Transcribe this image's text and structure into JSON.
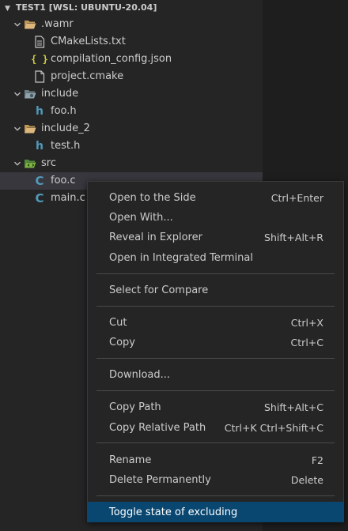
{
  "explorer": {
    "section_title": "TEST1 [WSL: UBUNTU-20.04]",
    "tree": [
      {
        "label": ".wamr",
        "kind": "folder",
        "expanded": true
      },
      {
        "label": "CMakeLists.txt",
        "kind": "file-lines"
      },
      {
        "label": "compilation_config.json",
        "kind": "json"
      },
      {
        "label": "project.cmake",
        "kind": "file-lines"
      },
      {
        "label": "include",
        "kind": "folder-special",
        "expanded": true
      },
      {
        "label": "foo.h",
        "kind": "h"
      },
      {
        "label": "include_2",
        "kind": "folder",
        "expanded": true
      },
      {
        "label": "test.h",
        "kind": "h"
      },
      {
        "label": "src",
        "kind": "folder-src",
        "expanded": true
      },
      {
        "label": "foo.c",
        "kind": "c"
      },
      {
        "label": "main.c",
        "kind": "c"
      }
    ]
  },
  "context_menu": {
    "items": [
      {
        "label": "Open to the Side",
        "shortcut": "Ctrl+Enter"
      },
      {
        "label": "Open With...",
        "shortcut": ""
      },
      {
        "label": "Reveal in Explorer",
        "shortcut": "Shift+Alt+R"
      },
      {
        "label": "Open in Integrated Terminal",
        "shortcut": ""
      },
      {
        "label": "Select for Compare",
        "shortcut": ""
      },
      {
        "label": "Cut",
        "shortcut": "Ctrl+X"
      },
      {
        "label": "Copy",
        "shortcut": "Ctrl+C"
      },
      {
        "label": "Download...",
        "shortcut": ""
      },
      {
        "label": "Copy Path",
        "shortcut": "Shift+Alt+C"
      },
      {
        "label": "Copy Relative Path",
        "shortcut": "Ctrl+K Ctrl+Shift+C"
      },
      {
        "label": "Rename",
        "shortcut": "F2"
      },
      {
        "label": "Delete Permanently",
        "shortcut": "Delete"
      },
      {
        "label": "Toggle state of excluding",
        "shortcut": ""
      }
    ],
    "highlighted_item": "Toggle state of excluding"
  },
  "colors": {
    "sidebar_bg": "#252526",
    "editor_bg": "#1e1e1e",
    "selected_row": "#37373d",
    "menu_highlight": "#094771",
    "folder_yellow": "#dcb67a",
    "file_blue": "#519aba",
    "json_yellow": "#cbcb41"
  }
}
